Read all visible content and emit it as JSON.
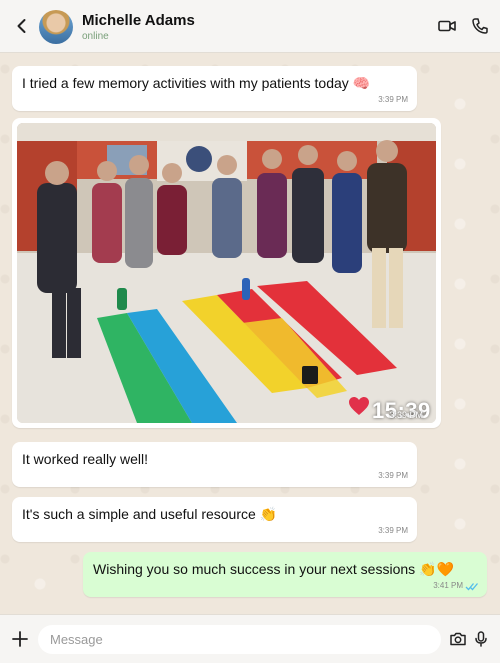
{
  "contact": {
    "name": "Michelle Adams",
    "status": "online"
  },
  "icons": {
    "back": "chevron-left-icon",
    "video": "video-camera-icon",
    "call": "phone-icon",
    "attach": "plus-icon",
    "camera": "camera-icon",
    "mic": "microphone-icon"
  },
  "messages": [
    {
      "direction": "in",
      "text": "I tried a few memory activities with my patients today 🧠",
      "time": "3:39 PM"
    },
    {
      "direction": "in",
      "type": "photo",
      "time": "3:39 PM",
      "stamp": "15:39"
    },
    {
      "direction": "in",
      "text": "It worked really well!",
      "time": "3:39 PM"
    },
    {
      "direction": "in",
      "text": "It's such a simple and useful resource 👏",
      "time": "3:39 PM"
    },
    {
      "direction": "out",
      "text": "Wishing you so much success in your next sessions 👏🧡",
      "time": "3:41 PM",
      "read": true
    }
  ],
  "composer": {
    "placeholder": "Message"
  },
  "colors": {
    "outgoing_bubble": "#d9fdd3",
    "incoming_bubble": "#ffffff",
    "read_ticks": "#53bdeb"
  }
}
